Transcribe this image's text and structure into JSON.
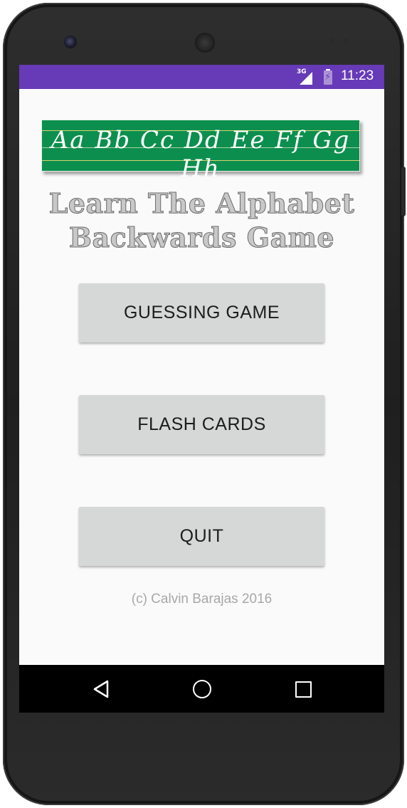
{
  "status_bar": {
    "network_label": "3G",
    "time": "11:23",
    "background_color": "#673ab7"
  },
  "banner": {
    "letters": "Aa Bb Cc Dd Ee Ff Gg Hh",
    "background_color": "#0c8f4e"
  },
  "title": {
    "line1": "Learn The Alphabet",
    "line2": "Backwards Game"
  },
  "buttons": {
    "guessing_game": "GUESSING GAME",
    "flash_cards": "FLASH CARDS",
    "quit": "QUIT"
  },
  "footer": {
    "copyright": "(c) Calvin Barajas 2016"
  },
  "nav_bar": {
    "back_icon": "triangle-back-icon",
    "home_icon": "circle-home-icon",
    "recents_icon": "square-recents-icon"
  }
}
